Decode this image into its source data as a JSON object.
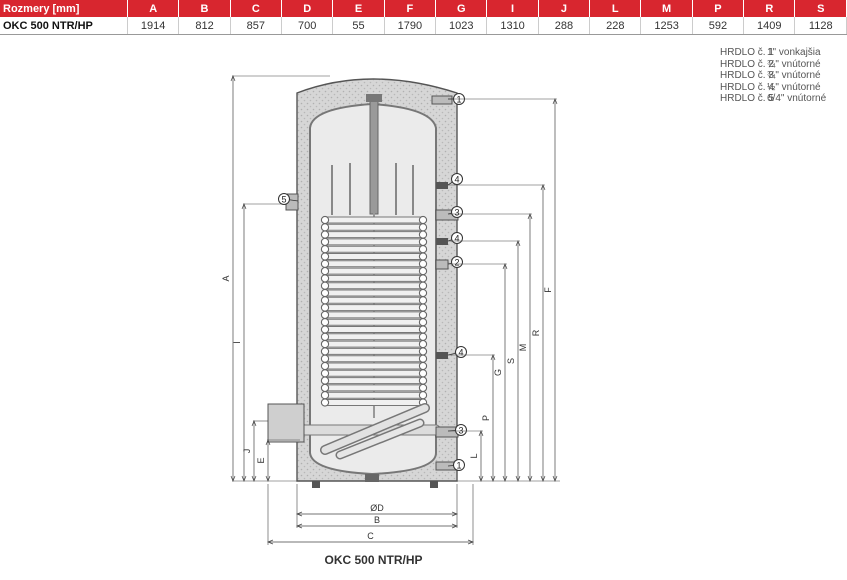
{
  "table": {
    "header_label": "Rozmery [mm]",
    "columns": [
      "A",
      "B",
      "C",
      "D",
      "E",
      "F",
      "G",
      "I",
      "J",
      "L",
      "M",
      "P",
      "R",
      "S"
    ],
    "row": {
      "model": "OKC 500 NTR/HP",
      "values": [
        "1914",
        "812",
        "857",
        "700",
        "55",
        "1790",
        "1023",
        "1310",
        "288",
        "228",
        "1253",
        "592",
        "1409",
        "1128"
      ]
    }
  },
  "legend": [
    {
      "label": "HRDLO č. 1",
      "desc": "1\" vonkajšia"
    },
    {
      "label": "HRDLO č. 2",
      "desc": "¾\" vnútorné"
    },
    {
      "label": "HRDLO č. 3",
      "desc": "¾\" vnútorné"
    },
    {
      "label": "HRDLO č. 4",
      "desc": "½\" vnútorné"
    },
    {
      "label": "HRDLO č. 5",
      "desc": "6/4\" vnútorné"
    }
  ],
  "diagram": {
    "callouts": [
      "1",
      "4",
      "3",
      "4",
      "2",
      "4",
      "3",
      "1",
      "5"
    ],
    "dim_labels": {
      "A": "A",
      "I": "I",
      "J": "J",
      "E": "E",
      "F": "F",
      "R": "R",
      "M": "M",
      "S": "S",
      "G": "G",
      "P": "P",
      "L": "L",
      "D": "ØD",
      "B": "B",
      "C": "C"
    }
  },
  "caption": "OKC 500 NTR/HP",
  "colors": {
    "header_red": "#d8262f",
    "insulation": "#cfcfcf",
    "steel": "#9a9a9a"
  }
}
